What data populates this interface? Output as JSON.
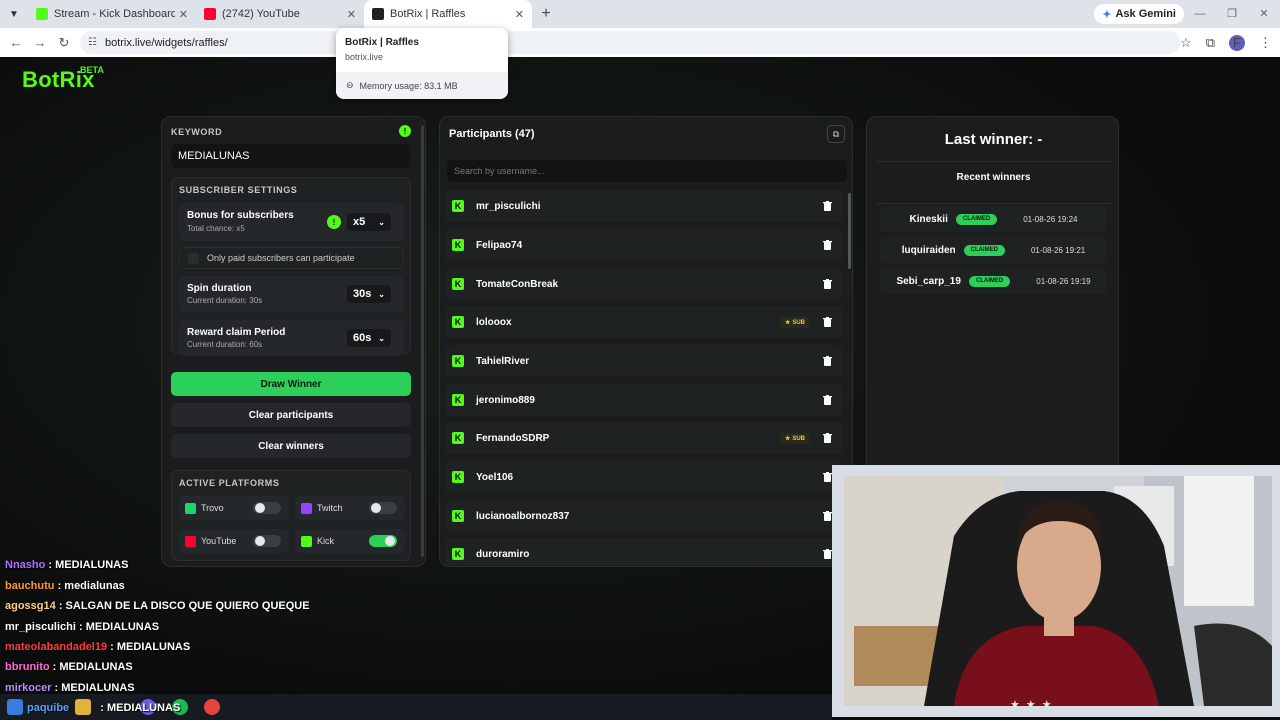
{
  "browser": {
    "tabs": [
      {
        "title": "Stream - Kick Dashboard",
        "fav_color": "#53fc18"
      },
      {
        "title": "(2742) YouTube",
        "fav_color": "#ff0033"
      },
      {
        "title": "BotRix | Raffles",
        "fav_color": "#222222"
      }
    ],
    "gemini_label": "Ask Gemini",
    "url": "botrix.live/widgets/raffles/",
    "profile_initial": "F",
    "hovercard": {
      "title": "BotRix | Raffles",
      "host": "botrix.live",
      "memory": "Memory usage: 83.1 MB"
    }
  },
  "app": {
    "brand": "BotRix",
    "beta": "BETA",
    "keyword": {
      "label": "KEYWORD",
      "value": "MEDIALUNAS"
    },
    "subscriber_settings": {
      "label": "SUBSCRIBER SETTINGS",
      "bonus_title": "Bonus for subscribers",
      "bonus_sub": "Total chance: x5",
      "bonus_value": "x5",
      "paid_only": "Only paid subscribers can participate"
    },
    "spin": {
      "title": "Spin duration",
      "sub": "Current duration: 30s",
      "value": "30s"
    },
    "reward": {
      "title": "Reward claim Period",
      "sub": "Current duration: 60s",
      "value": "60s"
    },
    "buttons": {
      "draw": "Draw Winner",
      "clear_participants": "Clear participants",
      "clear_winners": "Clear winners"
    },
    "platforms": {
      "label": "ACTIVE PLATFORMS",
      "items": [
        {
          "name": "Trovo",
          "color": "#19d66b",
          "on": false
        },
        {
          "name": "Twitch",
          "color": "#9146ff",
          "on": false
        },
        {
          "name": "YouTube",
          "color": "#ff0033",
          "on": false
        },
        {
          "name": "Kick",
          "color": "#53fc18",
          "on": true
        }
      ]
    },
    "participants": {
      "title": "Participants (47)",
      "search_placeholder": "Search by username...",
      "sub_tag": "SUB",
      "items": [
        {
          "name": "mr_pisculichi",
          "sub": false
        },
        {
          "name": "Felipao74",
          "sub": false
        },
        {
          "name": "TomateConBreak",
          "sub": false
        },
        {
          "name": "lolooox",
          "sub": true
        },
        {
          "name": "TahielRiver",
          "sub": false
        },
        {
          "name": "jeronimo889",
          "sub": false
        },
        {
          "name": "FernandoSDRP",
          "sub": true
        },
        {
          "name": "Yoel106",
          "sub": false
        },
        {
          "name": "lucianoalbornoz837",
          "sub": false
        },
        {
          "name": "duroramiro",
          "sub": false
        }
      ]
    },
    "winners": {
      "last_winner": "Last winner: -",
      "recent_title": "Recent winners",
      "status": "CLAIMED",
      "items": [
        {
          "name": "Kineskii",
          "date": "01-08-26 19:24"
        },
        {
          "name": "luquiraiden",
          "date": "01-08-26 19:21"
        },
        {
          "name": "Sebi_carp_19",
          "date": "01-08-26 19:19"
        }
      ]
    }
  },
  "chat": [
    {
      "user": "Nnasho",
      "color": "#b46cff",
      "text": ": MEDIALUNAS"
    },
    {
      "user": "bauchutu",
      "color": "#ff9a2e",
      "text": ": medialunas"
    },
    {
      "user": "agossg14",
      "color": "#ffd27a",
      "text": ": SALGAN DE LA DISCO QUE QUIERO QUEQUE"
    },
    {
      "user": "mr_pisculichi",
      "color": "#ffffff",
      "text": ": MEDIALUNAS"
    },
    {
      "user": "mateolabandadel19",
      "color": "#ff3b3b",
      "text": ": MEDIALUNAS"
    },
    {
      "user": "bbrunito",
      "color": "#ff6ad5",
      "text": ": MEDIALUNAS"
    },
    {
      "user": "mirkocer",
      "color": "#c08bff",
      "text": ": MEDIALUNAS"
    },
    {
      "user": "paquibe",
      "color": "#5aa0ff",
      "text": ": MEDIALUNAS"
    }
  ]
}
